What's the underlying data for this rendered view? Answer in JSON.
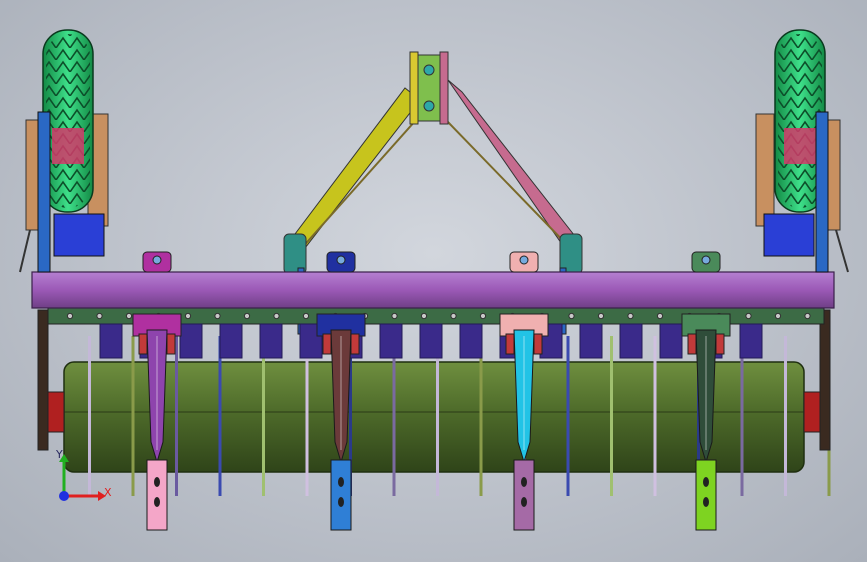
{
  "viewport": {
    "background": "#c4c8d0",
    "triad": {
      "x_label": "X",
      "y_label": "Y",
      "x_color": "#e02020",
      "y_color": "#20b020",
      "origin_color": "#2030e0"
    }
  },
  "model": {
    "parts": [
      {
        "name": "tire-left",
        "color": "#2ecc71"
      },
      {
        "name": "tire-right",
        "color": "#2ecc71"
      },
      {
        "name": "main-frame-beam",
        "color": "#9b59b6"
      },
      {
        "name": "hitch-arm-left",
        "color": "#c7c41d"
      },
      {
        "name": "hitch-arm-right",
        "color": "#c66b8f"
      },
      {
        "name": "roller-drum",
        "color": "#4e6b2a"
      }
    ],
    "shanks": [
      {
        "name": "shank-1",
        "color": "#8e44ad",
        "foot_color": "#f4a6c8"
      },
      {
        "name": "shank-2",
        "color": "#6b3a3a",
        "foot_color": "#2f7fd6"
      },
      {
        "name": "shank-3",
        "color": "#22c3e6",
        "foot_color": "#a56aa6"
      },
      {
        "name": "shank-4",
        "color": "#2f4d3a",
        "foot_color": "#7ed321"
      }
    ],
    "clamp_colors": [
      "#b030a0",
      "#2030a0",
      "#f0b0b0",
      "#4a8a5a"
    ]
  }
}
